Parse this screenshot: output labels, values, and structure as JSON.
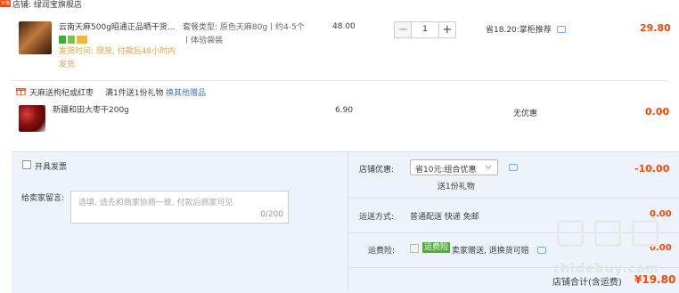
{
  "shop": {
    "tag": "天猫",
    "name": "店铺: 绿润宝旗舰店"
  },
  "item1": {
    "title": "云南天麻500g昭通正品晒干货...",
    "sku": "套餐类型: 原色天麻80g丨约4-5个丨体验袋装",
    "shipping": "发货时间: 现货, 付款后48小时内发货",
    "unit_price": "48.00",
    "quantity": "1",
    "promo": "省18.20:掌柜推荐",
    "subtotal": "29.80",
    "minus": "−",
    "plus": "+"
  },
  "gift_bar": {
    "label": "天麻送枸杞或红枣",
    "rule": "满1件送1份礼物",
    "link": "换其他赠品"
  },
  "item2": {
    "title": "新疆和田大枣干200g",
    "unit_price": "6.90",
    "promo": "无优惠",
    "subtotal": "0.00"
  },
  "invoice": {
    "label": "开具发票"
  },
  "message": {
    "label": "给卖家留言:",
    "placeholder": "选填, 请先和商家协商一致, 付款后商家可见",
    "counter": "0/200"
  },
  "store_discount": {
    "label": "店铺优惠:",
    "selected": "省10元:组合优惠",
    "gift_note": "送1份礼物",
    "amount": "-10.00"
  },
  "delivery": {
    "label": "运送方式:",
    "value": "普通配送 快递 免邮",
    "amount": "0.00"
  },
  "insurance": {
    "label": "运费险:",
    "tag": "运费险",
    "value": "卖家赠送, 退换货可赔",
    "amount": "0.00"
  },
  "total": {
    "label": "店铺合计(含运费)",
    "amount": "¥19.80"
  },
  "watermark": {
    "text": "zhidebuy.com"
  },
  "colors": {
    "accent": "#ff4400",
    "panel": "#eef3fb",
    "link": "#3c73c6",
    "ship": "#e6a23c"
  }
}
